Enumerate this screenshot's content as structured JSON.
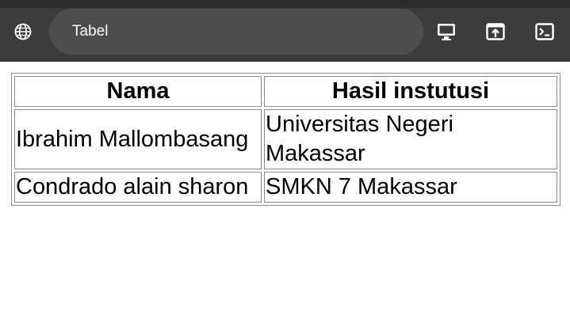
{
  "address_bar": {
    "text": "Tabel",
    "icon": "globe-icon"
  },
  "toolbar": {
    "icons": [
      "monitor-icon",
      "open-in-new-icon",
      "terminal-icon"
    ]
  },
  "table": {
    "headers": [
      "Nama",
      "Hasil instutusi"
    ],
    "rows": [
      [
        "Ibrahim Mallombasang",
        "Universitas Negeri Makassar"
      ],
      [
        "Condrado alain sharon",
        "SMKN 7 Makassar"
      ]
    ]
  },
  "colors": {
    "toolbar_bg": "#3c3c3c",
    "address_bg": "#4d4d4d",
    "icon": "#ffffff"
  }
}
